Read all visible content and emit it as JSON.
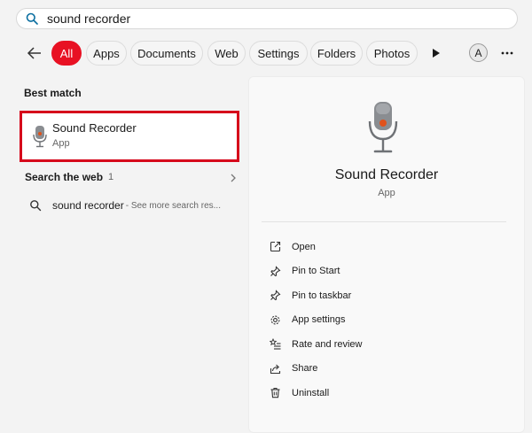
{
  "search": {
    "query": "sound recorder"
  },
  "filters": {
    "chips": [
      {
        "label": "All",
        "active": true
      },
      {
        "label": "Apps"
      },
      {
        "label": "Documents"
      },
      {
        "label": "Web"
      },
      {
        "label": "Settings"
      },
      {
        "label": "Folders"
      },
      {
        "label": "Photos"
      }
    ],
    "avatar_letter": "A"
  },
  "best_match": {
    "section_label": "Best match",
    "name": "Sound Recorder",
    "type": "App"
  },
  "web": {
    "section_label": "Search the web",
    "count": "1",
    "result_query": "sound recorder",
    "result_hint": "- See more search res..."
  },
  "detail": {
    "title": "Sound Recorder",
    "subtitle": "App",
    "actions": [
      {
        "label": "Open",
        "icon": "open-icon"
      },
      {
        "label": "Pin to Start",
        "icon": "pin-icon"
      },
      {
        "label": "Pin to taskbar",
        "icon": "pin-icon"
      },
      {
        "label": "App settings",
        "icon": "gear-icon"
      },
      {
        "label": "Rate and review",
        "icon": "star-list-icon"
      },
      {
        "label": "Share",
        "icon": "share-icon"
      },
      {
        "label": "Uninstall",
        "icon": "trash-icon"
      }
    ]
  },
  "colors": {
    "accent": "#e81123",
    "highlight_border": "#d6071b",
    "search_icon": "#0a6ea0",
    "mic_body": "#8a8d91",
    "mic_light": "#e0521b"
  }
}
